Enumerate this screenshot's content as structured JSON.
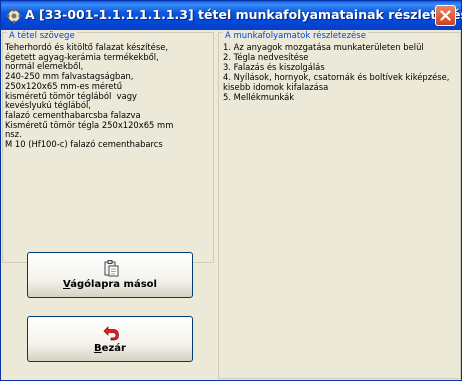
{
  "window": {
    "title": "A [33-001-1.1.1.1.1.1.3] tétel munkafolyamatainak részletezése"
  },
  "item_text": {
    "legend": "A tétel szövege",
    "body": "Teherhordó és kitöltő falazat készítése,\négetett agyag-kerámia termékekből,\nnormál elemekből,\n240-250 mm falvastagságban,\n250x120x65 mm-es méretű\nkisméretű tömör téglából  vagy\nkevéslyukú téglából,\nfalazó cementhabarcsba falazva\nKisméretű tömör tégla 250x120x65 mm\nnsz.\nM 10 (Hf100-c) falazó cementhabarcs"
  },
  "workflow": {
    "legend": "A munkafolyamatok részletezése",
    "items": [
      "1. Az anyagok mozgatása munkaterületen belül",
      "2. Tégla nedvesítése",
      "3. Falazás és kiszolgálás",
      "4. Nyílások, hornyok, csatornák és boltívek kiképzése, kisebb idomok kifalazása",
      "5. Mellékmunkák"
    ]
  },
  "buttons": {
    "copy": {
      "accel": "V",
      "rest": "ágólapra másol"
    },
    "close": {
      "accel": "B",
      "rest": "ezár"
    }
  }
}
